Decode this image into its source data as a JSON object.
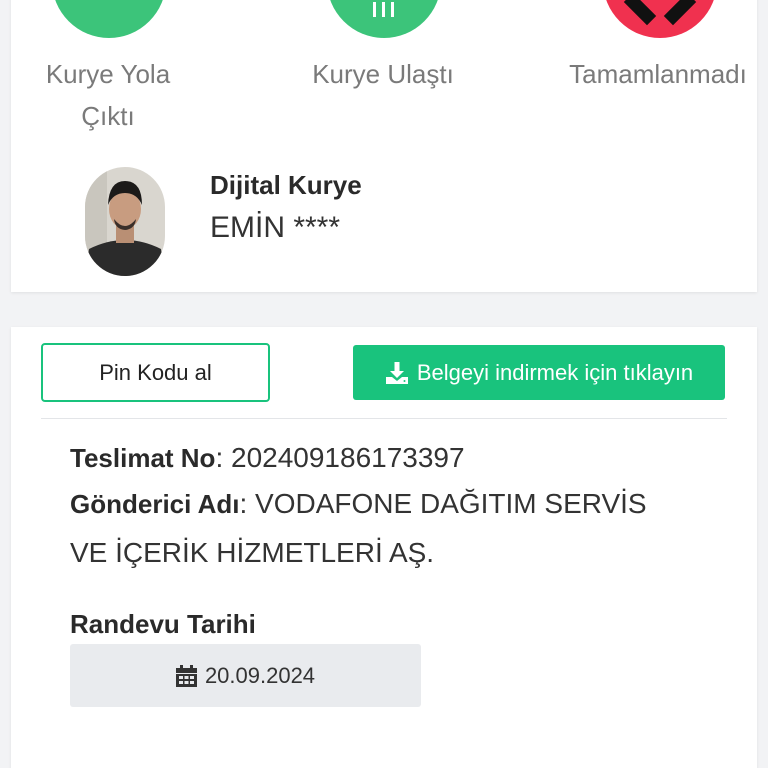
{
  "statuses": [
    {
      "label_line1": "Kurye Yola",
      "label_line2": "Çıktı",
      "icon": "check-icon",
      "color": "#3cc47a"
    },
    {
      "label_line1": "Kurye Ulaştı",
      "label_line2": "",
      "icon": "building-icon",
      "color": "#3cc47a"
    },
    {
      "label_line1": "Tamamlanmadı",
      "label_line2": "",
      "icon": "x-icon",
      "color": "#f0314f"
    }
  ],
  "courier": {
    "title": "Dijital Kurye",
    "name": "EMİN ****"
  },
  "actions": {
    "pin_label": "Pin Kodu al",
    "download_label": "Belgeyi indirmek için tıklayın",
    "accent_color": "#19c37d"
  },
  "delivery": {
    "number_label": "Teslimat No",
    "number_value": ": 202409186173397",
    "sender_label": "Gönderici Adı",
    "sender_value_line1": ": VODAFONE DAĞITIM SERVİS",
    "sender_value_line2": "VE İÇERİK HİZMETLERİ AŞ."
  },
  "appointment": {
    "label": "Randevu Tarihi",
    "date": "20.09.2024",
    "icon": "calendar-icon"
  }
}
